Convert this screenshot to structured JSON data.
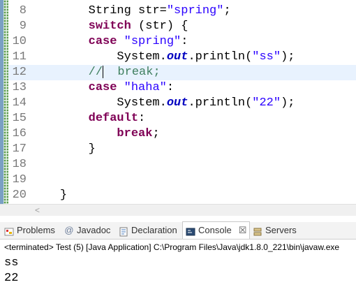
{
  "editor": {
    "lines": [
      {
        "num": "8",
        "indent": "        ",
        "tokens": [
          {
            "t": "String str=",
            "c": ""
          },
          {
            "t": "\"spring\"",
            "c": "str"
          },
          {
            "t": ";",
            "c": ""
          }
        ]
      },
      {
        "num": "9",
        "indent": "        ",
        "tokens": [
          {
            "t": "switch",
            "c": "kw"
          },
          {
            "t": " (str) {",
            "c": ""
          }
        ]
      },
      {
        "num": "10",
        "indent": "        ",
        "tokens": [
          {
            "t": "case",
            "c": "kw"
          },
          {
            "t": " ",
            "c": ""
          },
          {
            "t": "\"spring\"",
            "c": "str"
          },
          {
            "t": ":",
            "c": ""
          }
        ]
      },
      {
        "num": "11",
        "indent": "            ",
        "tokens": [
          {
            "t": "System.",
            "c": ""
          },
          {
            "t": "out",
            "c": "field"
          },
          {
            "t": ".println(",
            "c": ""
          },
          {
            "t": "\"ss\"",
            "c": "str"
          },
          {
            "t": ");",
            "c": ""
          }
        ]
      },
      {
        "num": "12",
        "indent": "        ",
        "current": true,
        "tokens": [
          {
            "t": "//",
            "c": "cmt"
          },
          {
            "t": "CARET",
            "c": "caret"
          },
          {
            "t": "  break;",
            "c": "cmt"
          }
        ]
      },
      {
        "num": "13",
        "indent": "        ",
        "tokens": [
          {
            "t": "case",
            "c": "kw"
          },
          {
            "t": " ",
            "c": ""
          },
          {
            "t": "\"haha\"",
            "c": "str"
          },
          {
            "t": ":",
            "c": ""
          }
        ]
      },
      {
        "num": "14",
        "indent": "            ",
        "tokens": [
          {
            "t": "System.",
            "c": ""
          },
          {
            "t": "out",
            "c": "field"
          },
          {
            "t": ".println(",
            "c": ""
          },
          {
            "t": "\"22\"",
            "c": "str"
          },
          {
            "t": ");",
            "c": ""
          }
        ]
      },
      {
        "num": "15",
        "indent": "        ",
        "tokens": [
          {
            "t": "default",
            "c": "kw"
          },
          {
            "t": ":",
            "c": ""
          }
        ]
      },
      {
        "num": "16",
        "indent": "            ",
        "tokens": [
          {
            "t": "break",
            "c": "kw"
          },
          {
            "t": ";",
            "c": ""
          }
        ]
      },
      {
        "num": "17",
        "indent": "        ",
        "tokens": [
          {
            "t": "}",
            "c": ""
          }
        ]
      },
      {
        "num": "18",
        "indent": "",
        "tokens": []
      },
      {
        "num": "19",
        "indent": "",
        "tokens": []
      },
      {
        "num": "20",
        "indent": "    ",
        "tokens": [
          {
            "t": "}",
            "c": ""
          }
        ]
      }
    ]
  },
  "tabs": {
    "problems": "Problems",
    "javadoc": "Javadoc",
    "declaration": "Declaration",
    "console": "Console",
    "console_close": "☒",
    "servers": "Servers"
  },
  "console": {
    "status": "<terminated> Test (5) [Java Application] C:\\Program Files\\Java\\jdk1.8.0_221\\bin\\javaw.exe",
    "output": [
      "ss",
      "22"
    ]
  },
  "colors": {
    "keyword": "#7f0055",
    "string": "#2a00ff",
    "field": "#0000c0",
    "comment": "#3f7f5f",
    "current_line": "#e8f2fe"
  },
  "icons": {
    "problems": "problems-icon",
    "javadoc": "javadoc-icon",
    "declaration": "declaration-icon",
    "console": "console-icon",
    "servers": "servers-icon"
  }
}
